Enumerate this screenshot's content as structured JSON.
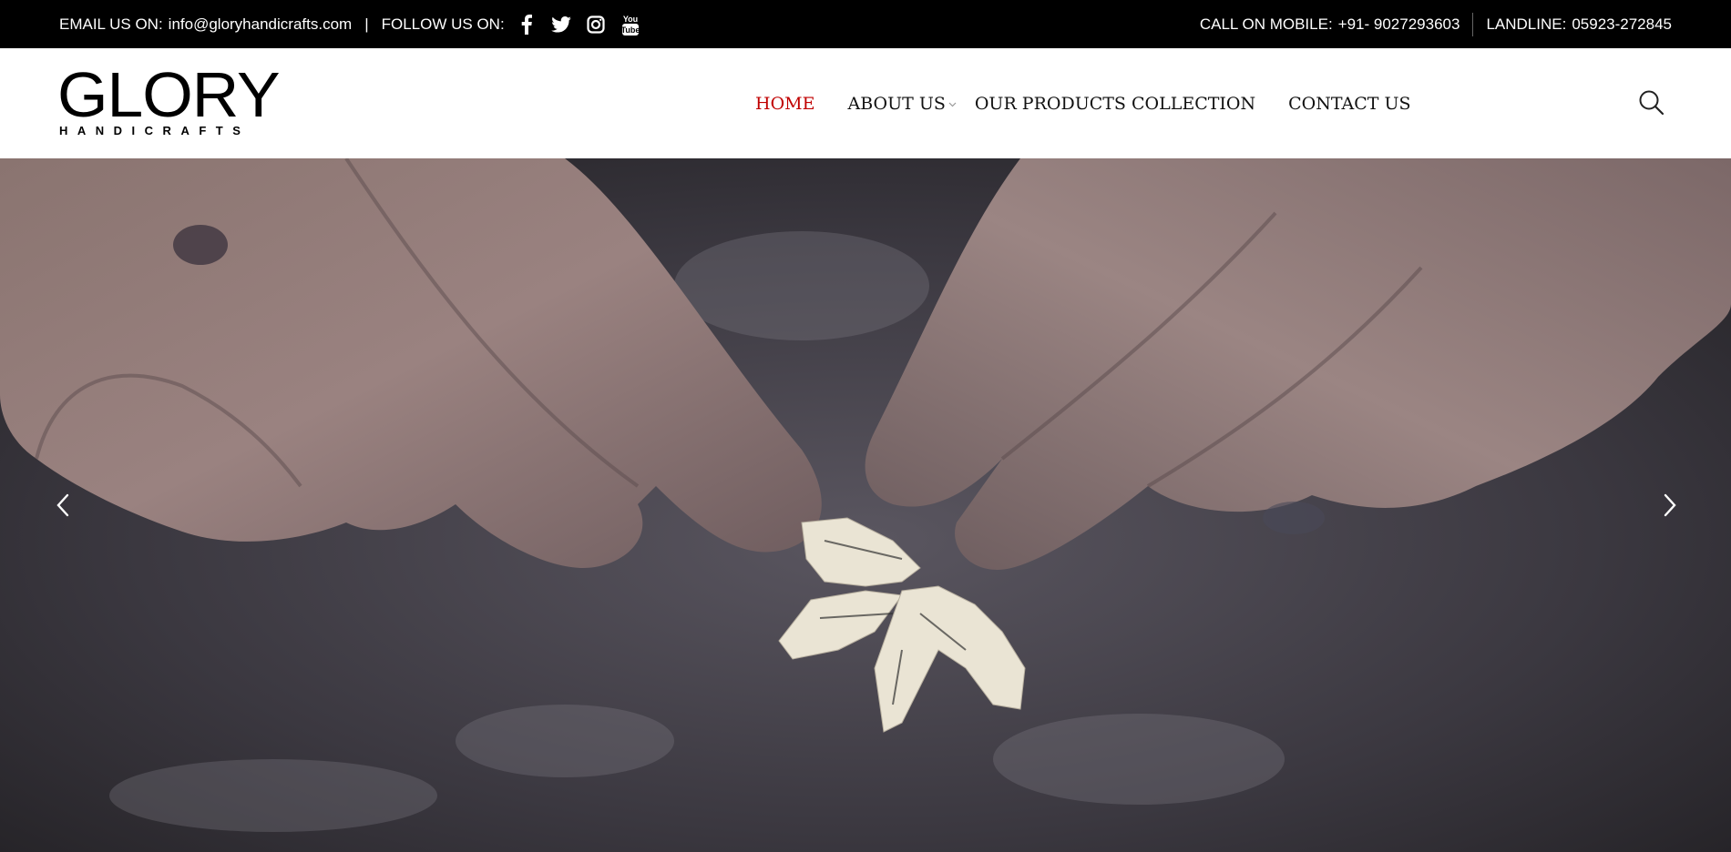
{
  "topbar": {
    "email_label": "EMAIL US ON:",
    "email_value": "info@gloryhandicrafts.com",
    "separator": "|",
    "follow_label": "FOLLOW US ON:",
    "social_icons": [
      "facebook-icon",
      "twitter-icon",
      "instagram-icon",
      "youtube-icon"
    ],
    "mobile_label": "CALL ON MOBILE:",
    "mobile_value": "+91- 9027293603",
    "landline_label": "LANDLINE:",
    "landline_value": "05923-272845"
  },
  "header": {
    "logo_main": "GLORY",
    "logo_sub": "HANDICRAFTS",
    "nav": [
      {
        "label": "HOME",
        "active": true
      },
      {
        "label": "ABOUT US",
        "has_dropdown": true
      },
      {
        "label": "OUR PRODUCTS COLLECTION"
      },
      {
        "label": "CONTACT US"
      }
    ],
    "search_icon": "search-icon"
  },
  "hero": {
    "prev_icon": "chevron-left-icon",
    "next_icon": "chevron-right-icon"
  },
  "colors": {
    "topbar_bg": "#000000",
    "header_bg": "#ffffff",
    "nav_active": "#c00000",
    "nav_text": "#111111"
  }
}
